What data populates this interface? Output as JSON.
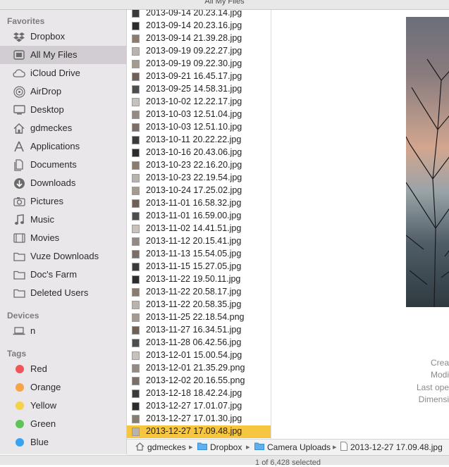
{
  "window": {
    "title": "All My Files"
  },
  "sidebar": {
    "favorites_header": "Favorites",
    "favorites": [
      {
        "label": "Dropbox",
        "icon": "dropbox-icon"
      },
      {
        "label": "All My Files",
        "icon": "all-my-files-icon",
        "selected": true
      },
      {
        "label": "iCloud Drive",
        "icon": "cloud-icon"
      },
      {
        "label": "AirDrop",
        "icon": "airdrop-icon"
      },
      {
        "label": "Desktop",
        "icon": "desktop-icon"
      },
      {
        "label": "gdmeckes",
        "icon": "home-icon"
      },
      {
        "label": "Applications",
        "icon": "applications-icon"
      },
      {
        "label": "Documents",
        "icon": "documents-icon"
      },
      {
        "label": "Downloads",
        "icon": "downloads-icon"
      },
      {
        "label": "Pictures",
        "icon": "camera-icon"
      },
      {
        "label": "Music",
        "icon": "music-note-icon"
      },
      {
        "label": "Movies",
        "icon": "film-icon"
      },
      {
        "label": "Vuze Downloads",
        "icon": "folder-icon"
      },
      {
        "label": "Doc's Farm",
        "icon": "folder-icon"
      },
      {
        "label": "Deleted Users",
        "icon": "folder-icon"
      }
    ],
    "devices_header": "Devices",
    "devices": [
      {
        "label": "n",
        "icon": "laptop-icon"
      }
    ],
    "tags_header": "Tags",
    "tags": [
      {
        "label": "Red",
        "color": "#f0555a"
      },
      {
        "label": "Orange",
        "color": "#f5a447"
      },
      {
        "label": "Yellow",
        "color": "#f5d24a"
      },
      {
        "label": "Green",
        "color": "#5cc557"
      },
      {
        "label": "Blue",
        "color": "#3aa3f1"
      }
    ]
  },
  "files": [
    "2013-09-14 20.23.14.jpg",
    "2013-09-14 20.23.16.jpg",
    "2013-09-14 21.39.28.jpg",
    "2013-09-19 09.22.27.jpg",
    "2013-09-19 09.22.30.jpg",
    "2013-09-21 16.45.17.jpg",
    "2013-09-25 14.58.31.jpg",
    "2013-10-02 12.22.17.jpg",
    "2013-10-03 12.51.04.jpg",
    "2013-10-03 12.51.10.jpg",
    "2013-10-11 20.22.22.jpg",
    "2013-10-16 20.43.06.jpg",
    "2013-10-23 22.16.20.jpg",
    "2013-10-23 22.19.54.jpg",
    "2013-10-24 17.25.02.jpg",
    "2013-11-01 16.58.32.jpg",
    "2013-11-01 16.59.00.jpg",
    "2013-11-02 14.41.51.jpg",
    "2013-11-12 20.15.41.jpg",
    "2013-11-13 15.54.05.jpg",
    "2013-11-15 15.27.05.jpg",
    "2013-11-22 19.50.11.jpg",
    "2013-11-22 20.58.17.jpg",
    "2013-11-22 20.58.35.jpg",
    "2013-11-25 22.18.54.png",
    "2013-11-27 16.34.51.jpg",
    "2013-11-28 06.42.56.jpg",
    "2013-12-01 15.00.54.jpg",
    "2013-12-01 21.35.29.png",
    "2013-12-02 20.16.55.png",
    "2013-12-18 18.42.24.jpg",
    "2013-12-27 17.01.07.jpg",
    "2013-12-27 17.01.30.jpg",
    "2013-12-27 17.09.48.jpg"
  ],
  "selected_file_index": 33,
  "preview": {
    "meta_labels": [
      "Crea",
      "Modi",
      "Last ope",
      "Dimensi"
    ]
  },
  "pathbar": {
    "crumbs": [
      {
        "label": "gdmeckes",
        "icon": "home-icon"
      },
      {
        "label": "Dropbox",
        "icon": "folder-icon"
      },
      {
        "label": "Camera Uploads",
        "icon": "folder-icon"
      },
      {
        "label": "2013-12-27 17.09.48.jpg",
        "icon": "file-icon"
      }
    ]
  },
  "status": {
    "text": "1 of 6,428 selected"
  },
  "colors": {
    "selection": "#f6c640",
    "sidebar_bg": "#e9e7ea",
    "sidebar_selected": "#d2cdd2"
  }
}
